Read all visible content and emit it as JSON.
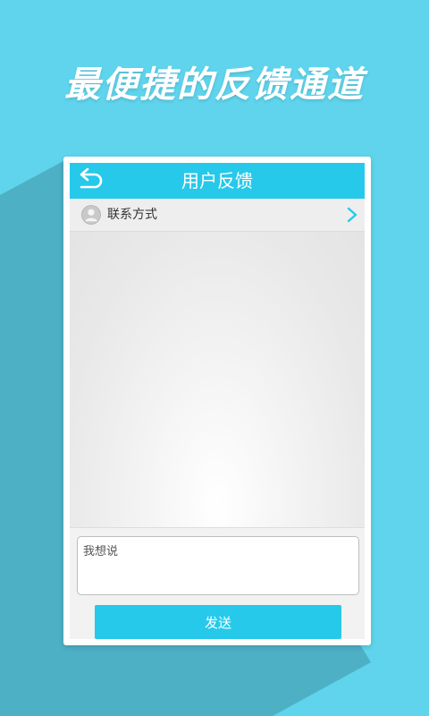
{
  "promo": {
    "title": "最便捷的反馈通道"
  },
  "header": {
    "title": "用户反馈",
    "back_icon": "back-arrow-icon"
  },
  "contact": {
    "label": "联系方式",
    "avatar_icon": "user-avatar-icon",
    "chevron_icon": "chevron-right-icon"
  },
  "compose": {
    "value": "",
    "placeholder": "我想说",
    "send_label": "发送"
  },
  "colors": {
    "background": "#5fd4ec",
    "accent": "#26c9ea",
    "shadow": "#4aa9bd",
    "frame": "#ffffff"
  }
}
